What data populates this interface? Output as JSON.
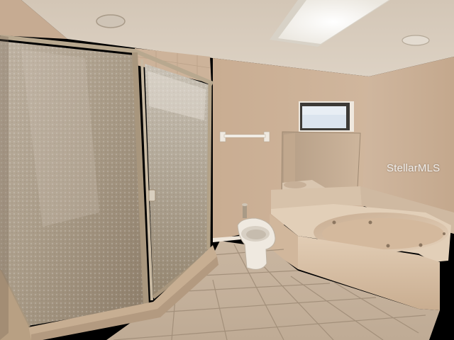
{
  "photo": {
    "watermark": "StellarMLS",
    "colors": {
      "wall": "#c8ad93",
      "ceiling": "#d9cdbd",
      "floor_tile": "#c4b09a",
      "grout": "#9d8b77",
      "tub": "#dcc6ad",
      "glass": "#b9ad9d",
      "frame": "#b5a58e",
      "skylight": "#f3f1ec",
      "window_sky": "#dbe4ee"
    }
  }
}
